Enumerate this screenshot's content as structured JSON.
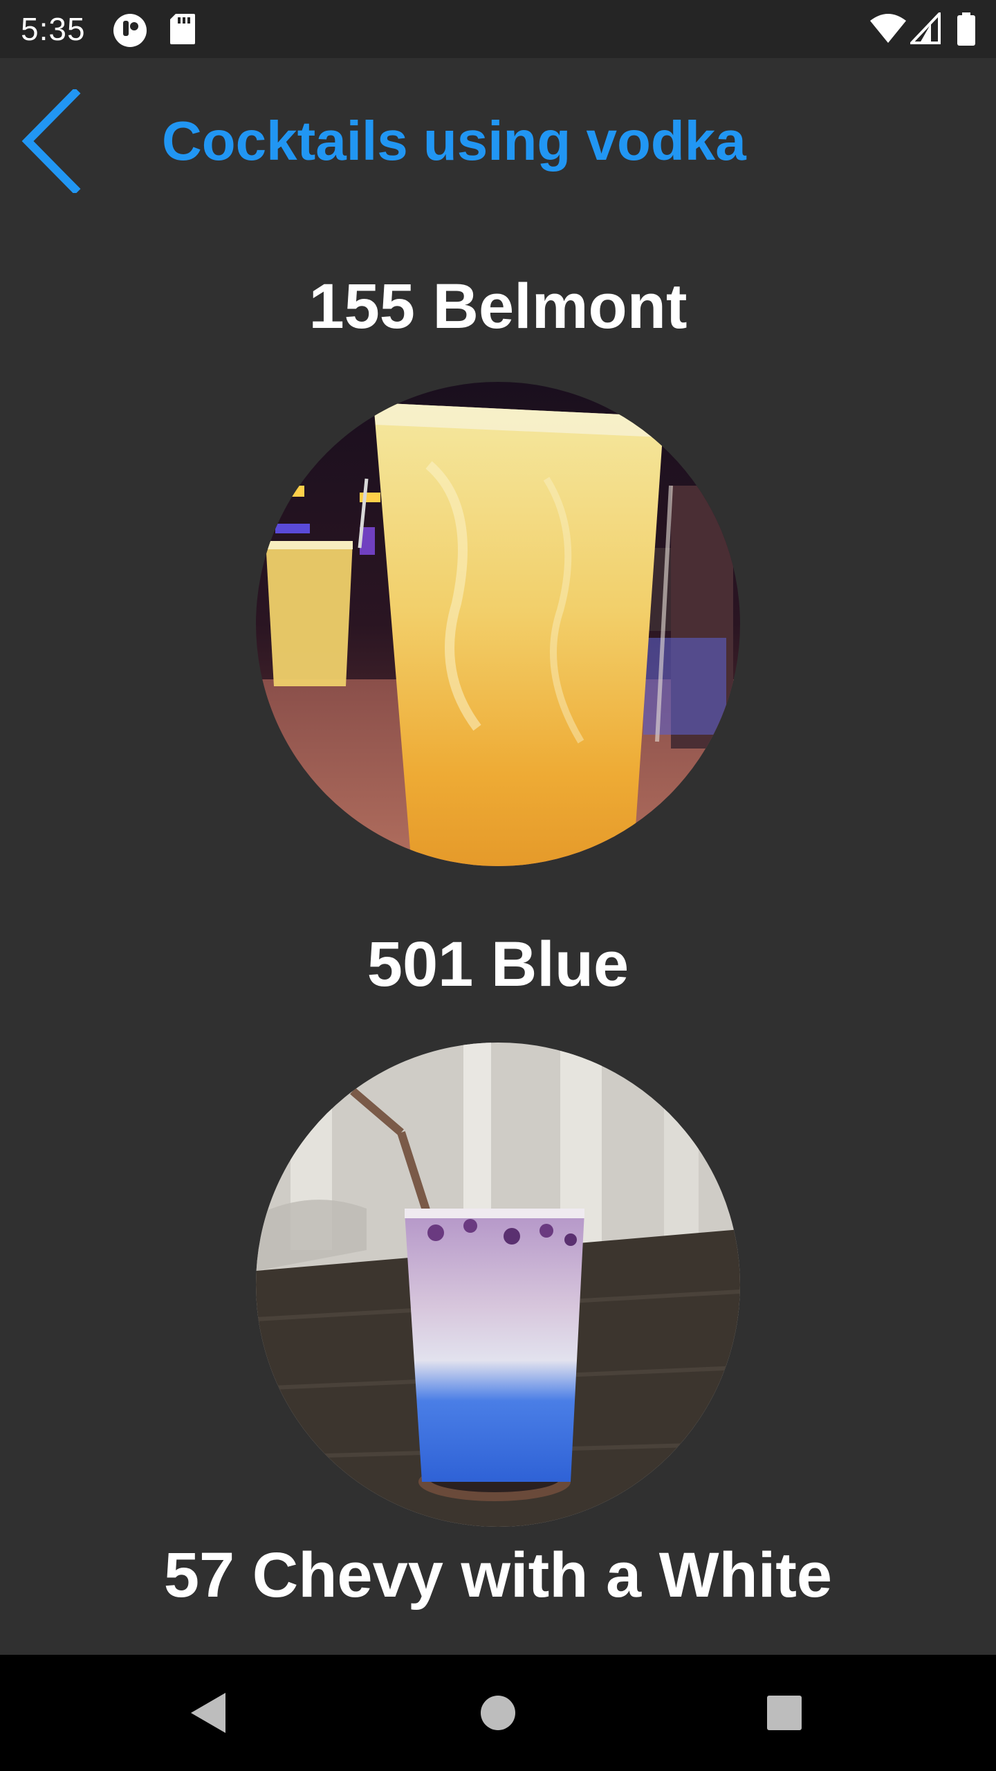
{
  "status_bar": {
    "time": "5:35",
    "left_icons": [
      "notification-app-icon",
      "sd-card-icon"
    ],
    "right_icons": [
      "wifi-icon",
      "cellular-signal-icon",
      "battery-icon"
    ]
  },
  "app_bar": {
    "back_icon": "chevron-left-icon",
    "title": "Cocktails using vodka"
  },
  "cocktails": [
    {
      "name": "155 Belmont",
      "photo": "orange-highball-drink-photo"
    },
    {
      "name": "501 Blue",
      "photo": "blue-layered-drink-photo"
    },
    {
      "name": "57 Chevy with a White",
      "photo": ""
    }
  ],
  "nav_bar": {
    "buttons": [
      "back-triangle-icon",
      "home-circle-icon",
      "recents-square-icon"
    ]
  },
  "colors": {
    "accent": "#2196f3",
    "background": "#303030",
    "status_bar": "#252525",
    "nav_bar": "#000000",
    "text": "#ffffff"
  }
}
